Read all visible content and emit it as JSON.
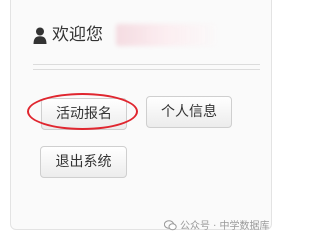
{
  "header": {
    "user_icon": "user-icon",
    "welcome_text": "欢迎您"
  },
  "actions": {
    "signup_label": "活动报名",
    "profile_label": "个人信息",
    "logout_label": "退出系统"
  },
  "annotation": {
    "highlight_color": "#e0262f"
  },
  "watermark": {
    "icon": "wechat-icon",
    "text": "公众号 · 中学数据库"
  }
}
